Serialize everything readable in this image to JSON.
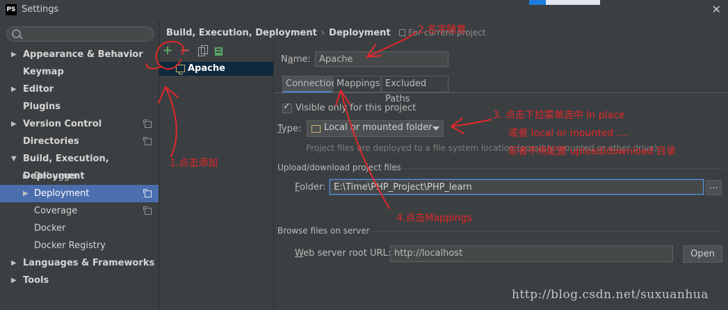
{
  "window": {
    "title": "Settings",
    "logo_text": "PS"
  },
  "sidebar": {
    "items": [
      {
        "label": "Appearance & Behavior",
        "arrow": "▶"
      },
      {
        "label": "Keymap",
        "arrow": ""
      },
      {
        "label": "Editor",
        "arrow": "▶"
      },
      {
        "label": "Plugins",
        "arrow": ""
      },
      {
        "label": "Version Control",
        "arrow": "▶"
      },
      {
        "label": "Directories",
        "arrow": ""
      },
      {
        "label": "Build, Execution, Deployment",
        "arrow": "▼"
      },
      {
        "label": "Debugger",
        "arrow": "▶"
      },
      {
        "label": "Deployment",
        "arrow": "▶"
      },
      {
        "label": "Coverage",
        "arrow": ""
      },
      {
        "label": "Docker",
        "arrow": ""
      },
      {
        "label": "Docker Registry",
        "arrow": ""
      },
      {
        "label": "Languages & Frameworks",
        "arrow": "▶"
      },
      {
        "label": "Tools",
        "arrow": "▶"
      }
    ]
  },
  "breadcrumb": {
    "parent": "Build, Execution, Deployment",
    "sep": "›",
    "current": "Deployment",
    "hint": "For current project"
  },
  "servers": {
    "add": "+",
    "remove": "−",
    "items": [
      "Apache"
    ]
  },
  "form": {
    "name_label_pre": "N",
    "name_label_u": "a",
    "name_label_post": "me:",
    "name_value": "Apache",
    "tabs": [
      "Connection",
      "Mappings",
      "Excluded Paths"
    ],
    "visible_only": "Visible only for this project",
    "type_label_u": "T",
    "type_label_post": "ype:",
    "type_value": "Local or mounted folder",
    "type_hint": "Project files are deployed to a file system location (possibly mounted or other drive).",
    "upload_section": "Upload/download project files",
    "folder_label_u": "F",
    "folder_label_post": "older:",
    "folder_value": "E:\\Time\\PHP_Project\\PHP_learn",
    "browse_label": "...",
    "browse_section": "Browse files on server",
    "web_label_u": "W",
    "web_label_post": "eb server root URL:",
    "web_value": "http://localhost",
    "open_label": "Open"
  },
  "annotations": {
    "a1": "1.点击添加",
    "a2": "2.名字随意",
    "a3_line1": "3.  点击下拉菜单选中 In place",
    "a3_line2": "或者 local or mounted ....",
    "a3_line3": "前者不用配置 upload/download 目录",
    "a4": "4.点击Mappings"
  },
  "watermark": "http://blog.csdn.net/suxuanhua"
}
